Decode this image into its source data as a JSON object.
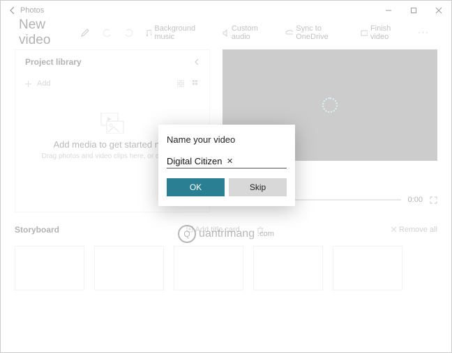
{
  "window": {
    "title": "Photos"
  },
  "toolbar": {
    "new_video": "New video",
    "bg_music": "Background music",
    "custom_audio": "Custom audio",
    "sync": "Sync to OneDrive",
    "finish": "Finish video"
  },
  "library": {
    "title": "Project library",
    "add": "Add",
    "empty_title": "Add media to get started now",
    "empty_sub": "Drag photos and video clips here, or click Add"
  },
  "preview": {
    "time": "0:00"
  },
  "storyboard": {
    "title": "Storyboard",
    "add_title": "Add title card",
    "remove_all": "Remove all"
  },
  "dialog": {
    "heading": "Name your video",
    "value": "Digital Citizen",
    "ok": "OK",
    "skip": "Skip"
  },
  "watermark": {
    "text": "uantrimang",
    "com": ".com"
  }
}
